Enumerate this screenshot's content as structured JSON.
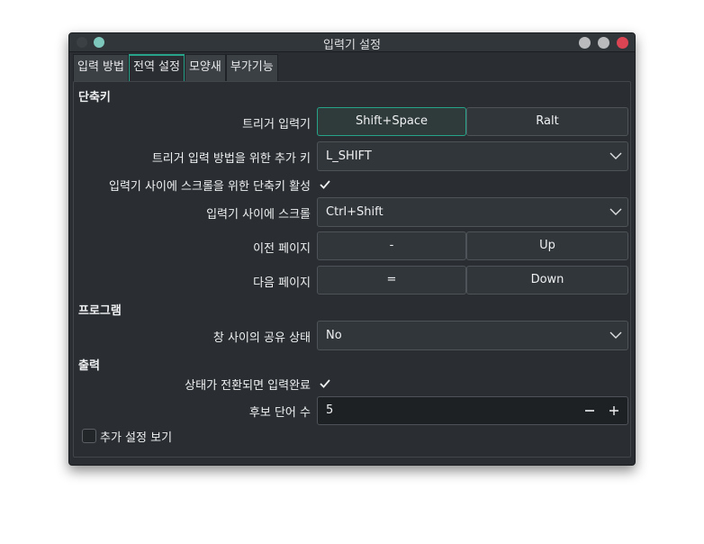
{
  "window": {
    "title": "입력기 설정"
  },
  "tabs": [
    {
      "label": "입력 방법",
      "active": false
    },
    {
      "label": "전역 설정",
      "active": true
    },
    {
      "label": "모양새",
      "active": false
    },
    {
      "label": "부가기능",
      "active": false
    }
  ],
  "sections": {
    "shortcuts": "단축키",
    "program": "프로그램",
    "output": "출력"
  },
  "shortcuts": {
    "trigger_label": "트리거 입력기",
    "trigger_keys": [
      "Shift+Space",
      "Ralt"
    ],
    "extra_trigger_label": "트리거 입력 방법을 위한 추가 키",
    "extra_trigger_value": "L_SHIFT",
    "enable_scroll_label": "입력기 사이에 스크롤을 위한 단축키 활성",
    "enable_scroll_checked": true,
    "scroll_label": "입력기 사이에 스크롤",
    "scroll_value": "Ctrl+Shift",
    "prev_page_label": "이전 페이지",
    "prev_page_keys": [
      "-",
      "Up"
    ],
    "next_page_label": "다음 페이지",
    "next_page_keys": [
      "=",
      "Down"
    ]
  },
  "program": {
    "share_state_label": "창 사이의 공유 상태",
    "share_state_value": "No"
  },
  "output": {
    "commit_on_switch_label": "상태가 전환되면 입력완료",
    "commit_on_switch_checked": true,
    "candidate_count_label": "후보 단어 수",
    "candidate_count_value": "5"
  },
  "advanced": {
    "label": "추가 설정 보기",
    "checked": false
  },
  "colors": {
    "accent": "#26a389",
    "close": "#da4453",
    "background": "#2a2e32",
    "button": "#31363b"
  }
}
